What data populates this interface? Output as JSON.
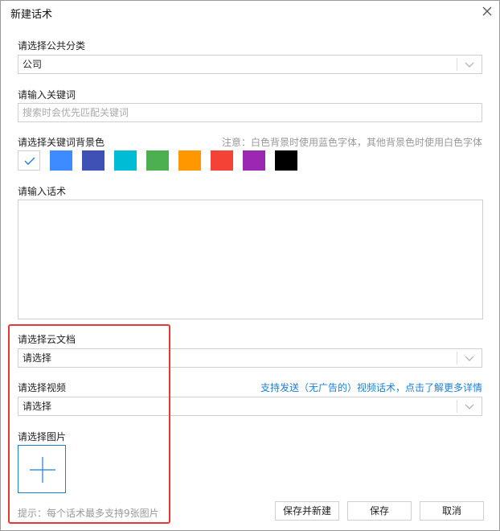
{
  "dialog": {
    "title": "新建话术"
  },
  "public_category": {
    "label": "请选择公共分类",
    "value": "公司"
  },
  "keyword": {
    "label": "请输入关键词",
    "placeholder": "搜索时会优先匹配关键词"
  },
  "keyword_color": {
    "label": "请选择关键词背景色",
    "note": "注意：白色背景时使用蓝色字体，其他背景色时使用白色字体",
    "selected_index": 0,
    "colors": [
      "#ffffff",
      "#3d8bff",
      "#3f51b5",
      "#00bcd4",
      "#4caf50",
      "#ff9800",
      "#f44336",
      "#9c27b0",
      "#000000"
    ]
  },
  "script_text": {
    "label": "请输入话术"
  },
  "cloud_doc": {
    "label": "请选择云文档",
    "value": "请选择"
  },
  "video": {
    "label": "请选择视频",
    "value": "请选择",
    "link": "支持发送（无广告的）视频话术，点击了解更多详情"
  },
  "image": {
    "label": "请选择图片",
    "hint": "提示：每个话术最多支持9张图片"
  },
  "buttons": {
    "save_and_new": "保存并新建",
    "save": "保存",
    "cancel": "取消"
  }
}
